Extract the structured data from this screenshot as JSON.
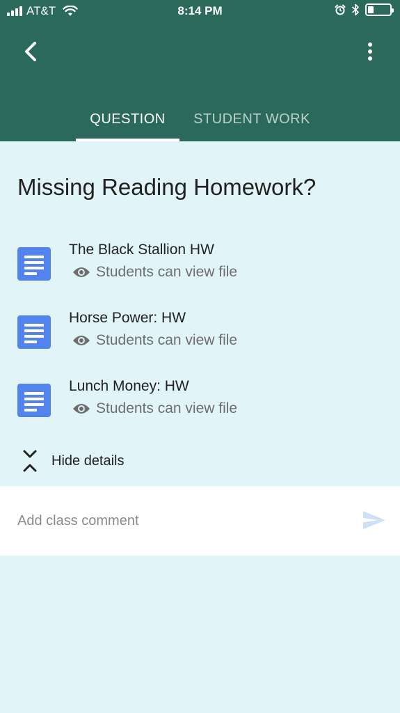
{
  "status_bar": {
    "carrier": "AT&T",
    "time": "8:14 PM",
    "battery_level": 0.2
  },
  "header": {
    "back_icon": "chevron-left-icon",
    "more_icon": "more-vert-icon",
    "tabs": [
      {
        "label": "QUESTION",
        "active": true
      },
      {
        "label": "STUDENT WORK",
        "active": false
      }
    ]
  },
  "question": {
    "title": "Missing Reading Homework?"
  },
  "attachments": [
    {
      "title": "The Black Stallion HW",
      "visibility": "Students can view file",
      "icon": "google-docs-icon"
    },
    {
      "title": "Horse Power: HW",
      "visibility": "Students can view file",
      "icon": "google-docs-icon"
    },
    {
      "title": "Lunch Money: HW",
      "visibility": "Students can view file",
      "icon": "google-docs-icon"
    }
  ],
  "details_toggle": {
    "label": "Hide details",
    "icon": "collapse-icon"
  },
  "comment": {
    "placeholder": "Add class comment",
    "value": "",
    "send_icon": "send-icon"
  },
  "colors": {
    "header_bg": "#2b6a5b",
    "page_bg": "#e1f4f8",
    "doc_icon_bg": "#5283ef",
    "send_icon": "#cde0f7"
  }
}
